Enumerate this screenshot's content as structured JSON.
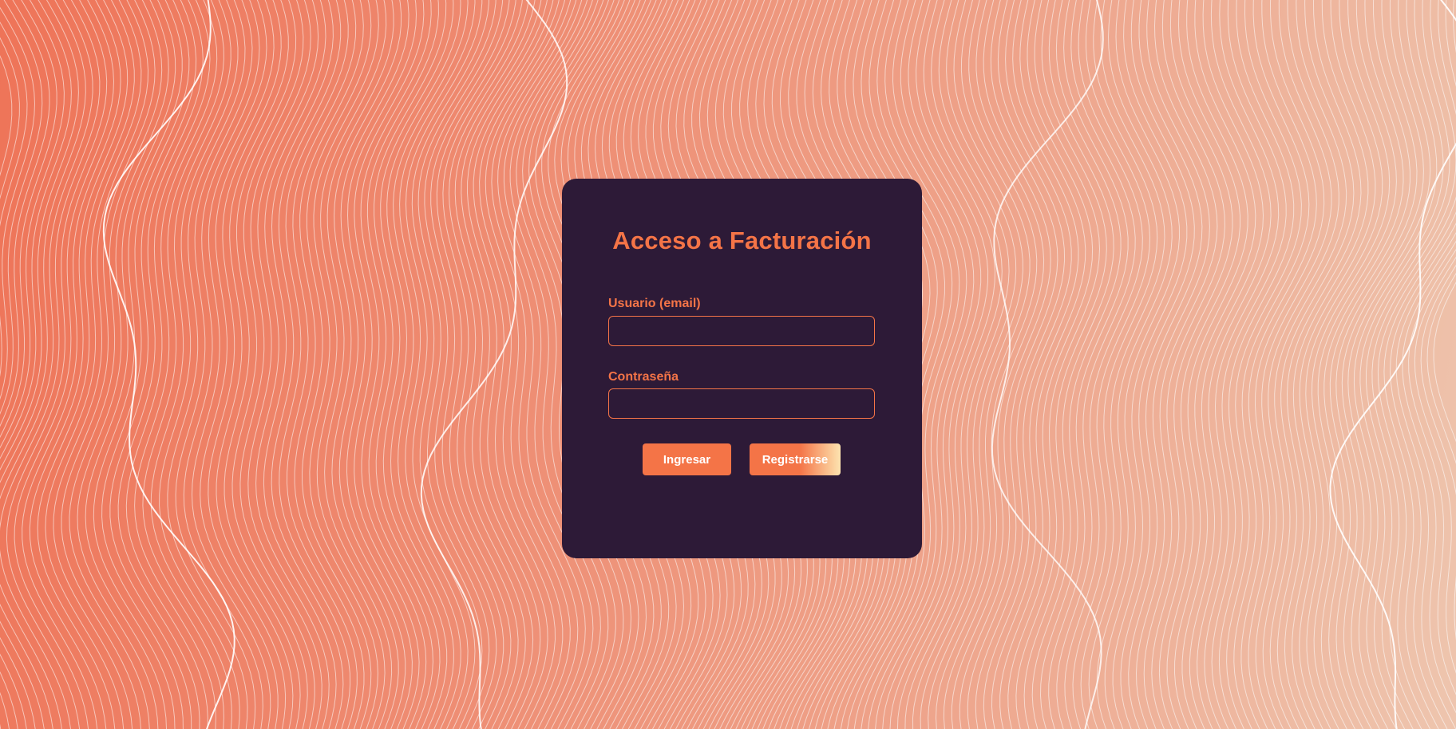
{
  "login": {
    "title": "Acceso a Facturación",
    "email_label": "Usuario (email)",
    "email_value": "",
    "password_label": "Contraseña",
    "password_value": "",
    "login_button": "Ingresar",
    "register_button": "Registrarse"
  },
  "colors": {
    "accent": "#f47447",
    "card_background": "#2d1a37",
    "background_start": "#ee7458",
    "background_end": "#eec5ae"
  }
}
